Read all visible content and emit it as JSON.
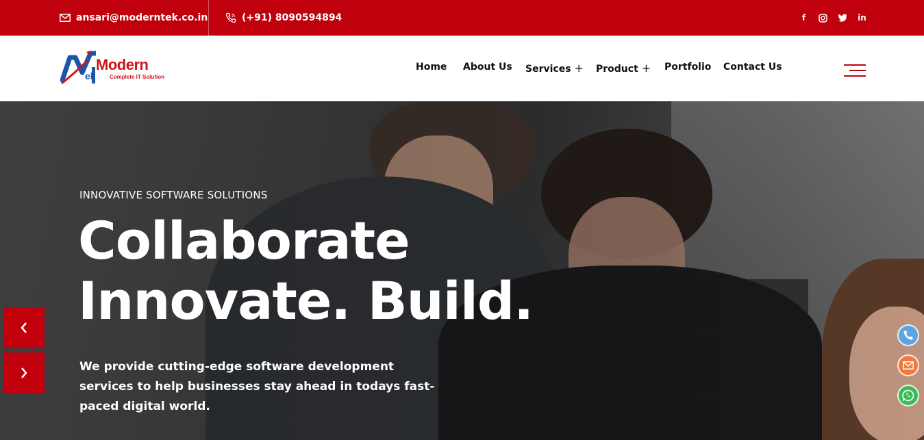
{
  "topbar": {
    "email": "ansari@moderntek.co.in",
    "phone": "(+91) 8090594894",
    "social": [
      {
        "icon": "facebook-icon",
        "glyph": "f"
      },
      {
        "icon": "instagram-icon",
        "glyph": ""
      },
      {
        "icon": "twitter-icon",
        "glyph": ""
      },
      {
        "icon": "linkedin-icon",
        "glyph": "in"
      }
    ]
  },
  "header": {
    "logo": {
      "word": "Modern",
      "ek": "ek",
      "tagline": "Complete IT Solution"
    },
    "nav": [
      {
        "label": "Home",
        "has_submenu": false
      },
      {
        "label": "About Us",
        "has_submenu": false
      },
      {
        "label": "Services",
        "has_submenu": true
      },
      {
        "label": "Product",
        "has_submenu": true
      },
      {
        "label": "Portfolio",
        "has_submenu": false
      },
      {
        "label": "Contact Us",
        "has_submenu": false
      }
    ],
    "submenu_indicator": "+"
  },
  "hero": {
    "eyebrow": "INNOVATIVE SOFTWARE SOLUTIONS",
    "headline_line1": "Collaborate",
    "headline_line2": "Innovate. Build.",
    "subtext": "We provide cutting-edge software development services to help businesses stay ahead in todays fast-paced digital world."
  },
  "floating_actions": [
    {
      "icon": "phone-icon",
      "color": "#5fa3e0"
    },
    {
      "icon": "mail-icon",
      "color": "#f07a3a"
    },
    {
      "icon": "whatsapp-icon",
      "color": "#3cba54"
    }
  ],
  "colors": {
    "brand_red": "#c0000d",
    "logo_blue": "#1a55a8"
  }
}
